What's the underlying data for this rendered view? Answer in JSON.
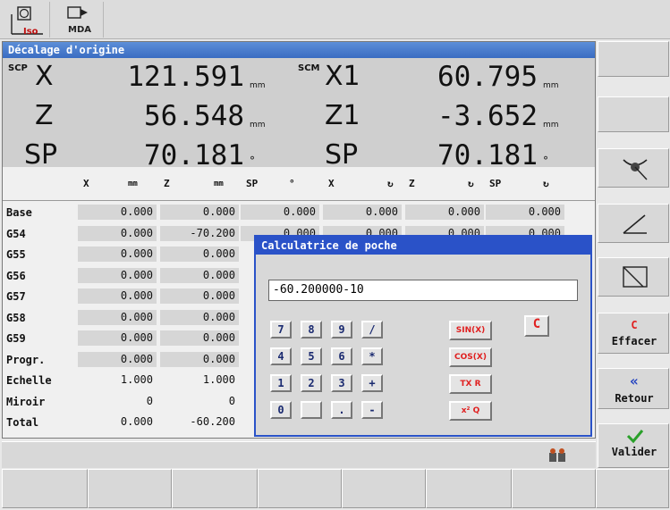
{
  "header": {
    "iso_label": "Iso",
    "mda_label": "MDA"
  },
  "panel": {
    "title": "Décalage d'origine"
  },
  "positions": {
    "left_tag": "SCP",
    "right_tag": "SCM",
    "rows": [
      {
        "axis": "X",
        "value": "121.591",
        "unit": "mm",
        "axis2": "X1",
        "value2": "60.795",
        "unit2": "mm"
      },
      {
        "axis": "Z",
        "value": "56.548",
        "unit": "mm",
        "axis2": "Z1",
        "value2": "-3.652",
        "unit2": "mm"
      },
      {
        "axis": "SP",
        "value": "70.181",
        "unit": "°",
        "axis2": "SP",
        "value2": "70.181",
        "unit2": "°"
      }
    ]
  },
  "table": {
    "headers": [
      {
        "axis": "X",
        "unit": "mm"
      },
      {
        "axis": "Z",
        "unit": "mm"
      },
      {
        "axis": "SP",
        "unit": "°"
      },
      {
        "axis": "X",
        "unit": "↻"
      },
      {
        "axis": "Z",
        "unit": "↻"
      },
      {
        "axis": "SP",
        "unit": "↻"
      }
    ],
    "rows": [
      {
        "label": "Base",
        "values": [
          "0.000",
          "0.000",
          "0.000",
          "0.000",
          "0.000",
          "0.000"
        ]
      },
      {
        "label": "G54",
        "values": [
          "0.000",
          "-70.200",
          "0.000",
          "0.000",
          "0.000",
          "0.000"
        ]
      },
      {
        "label": "G55",
        "values": [
          "0.000",
          "0.000"
        ]
      },
      {
        "label": "G56",
        "values": [
          "0.000",
          "0.000"
        ]
      },
      {
        "label": "G57",
        "values": [
          "0.000",
          "0.000"
        ]
      },
      {
        "label": "G58",
        "values": [
          "0.000",
          "0.000"
        ]
      },
      {
        "label": "G59",
        "values": [
          "0.000",
          "0.000"
        ]
      },
      {
        "label": "Progr.",
        "values": [
          "0.000",
          "0.000"
        ]
      },
      {
        "label": "Echelle",
        "values": [
          "1.000",
          "1.000"
        ]
      },
      {
        "label": "Miroir",
        "values": [
          "0",
          "0"
        ]
      },
      {
        "label": "Total",
        "values": [
          "0.000",
          "-60.200"
        ]
      }
    ]
  },
  "calculator": {
    "title": "Calculatrice de poche",
    "input_value": "-60.200000-10",
    "keys": [
      "7",
      "8",
      "9",
      "/",
      "4",
      "5",
      "6",
      "*",
      "1",
      "2",
      "3",
      "+",
      "0",
      "",
      ".",
      "-"
    ],
    "func_keys": [
      "SIN(X)",
      "COS(X)",
      "TX R",
      "x² Q"
    ],
    "clear_key": "C"
  },
  "softkeys": {
    "effacer_letter": "C",
    "effacer": "Effacer",
    "retour": "Retour",
    "valider": "Valider"
  },
  "colors": {
    "title_blue": "#3a6cc2",
    "calc_blue": "#2a52c8",
    "accent_red": "#e02020",
    "accent_green": "#2aa02a"
  }
}
